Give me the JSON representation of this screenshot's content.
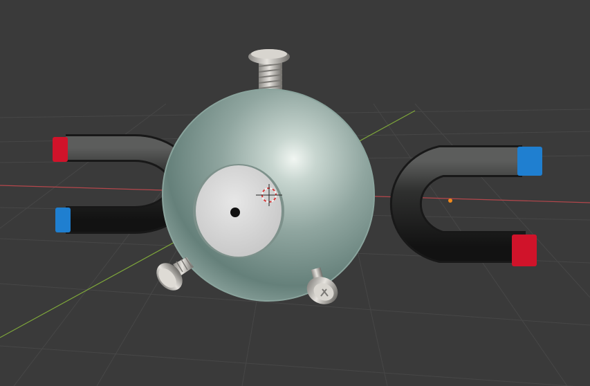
{
  "viewport": {
    "background": "#3a3a3a",
    "grid_color": "#4a4a4a",
    "x_axis_color": "#b5474c",
    "y_axis_color": "#7fa83a"
  },
  "scene": {
    "sphere_color": "#9fb3ad",
    "eye_color": "#d9d9d9",
    "pupil_color": "#111111",
    "screw_color": "#bdbab4",
    "magnet_body_color": "#2a2b2a",
    "magnet_north_color": "#d0132a",
    "magnet_south_color": "#1f7fd0",
    "origin_dot_color": "#f08a1c",
    "cursor_colors": [
      "#d83a3a",
      "#f4f4f4"
    ]
  }
}
